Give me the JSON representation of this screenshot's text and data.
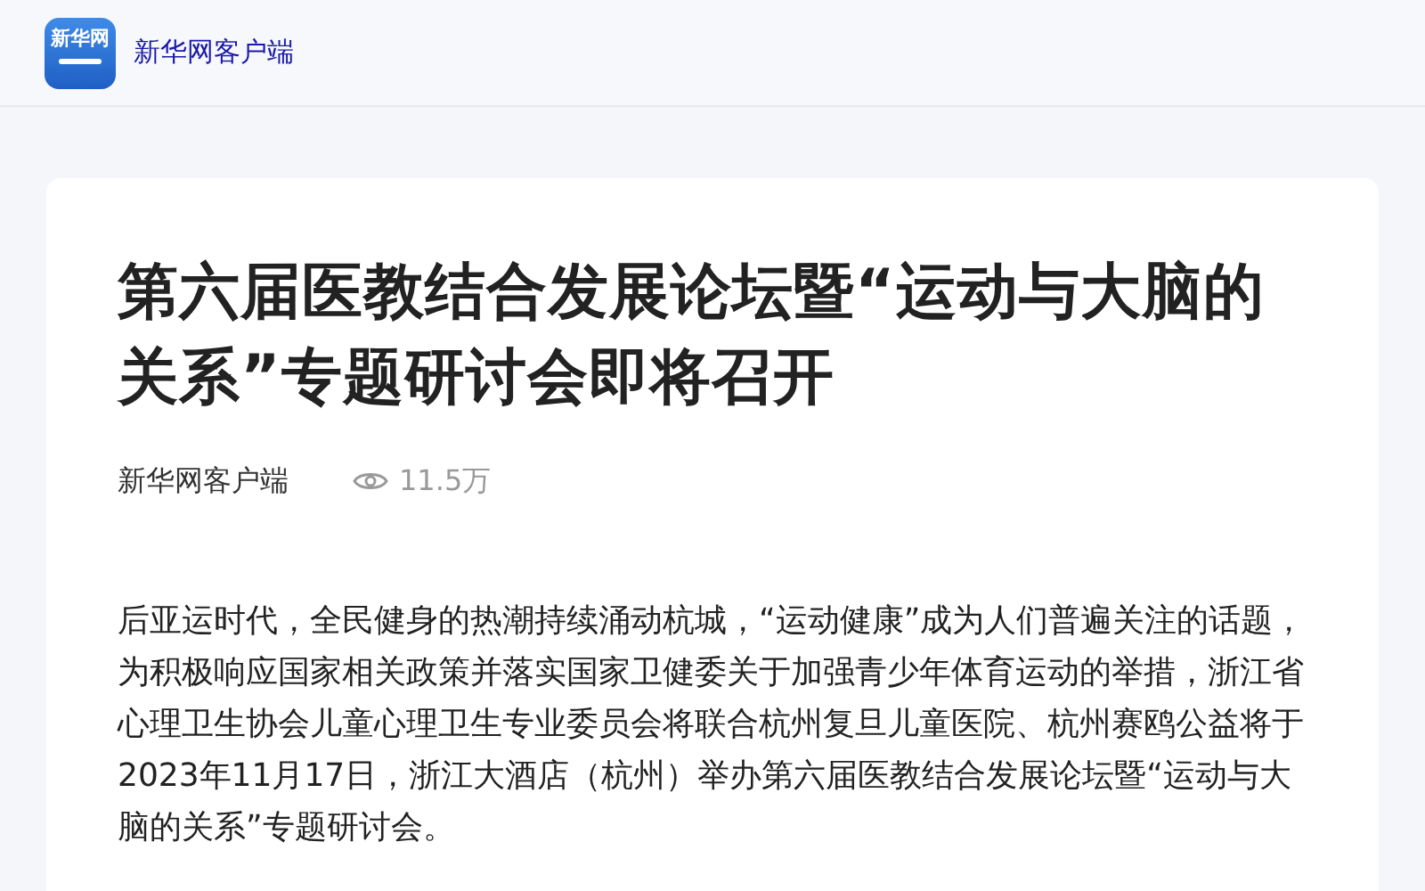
{
  "header": {
    "logo_text": "新华网",
    "app_name": "新华网客户端"
  },
  "article": {
    "title": "第六届医教结合发展论坛暨“运动与大脑的关系”专题研讨会即将召开",
    "source": "新华网客户端",
    "views": "11.5万",
    "paragraphs": [
      "后亚运时代，全民健身的热潮持续涌动杭城，“运动健康”成为人们普遍关注的话题，为积极响应国家相关政策并落实国家卫健委关于加强青少年体育运动的举措，浙江省心理卫生协会儿童心理卫生专业委员会将联合杭州复旦儿童医院、杭州赛鸥公益将于2023年11月17日，浙江大酒店（杭州）举办第六届医教结合发展论坛暨“运动与大脑的关系”专题研讨会。"
    ]
  }
}
